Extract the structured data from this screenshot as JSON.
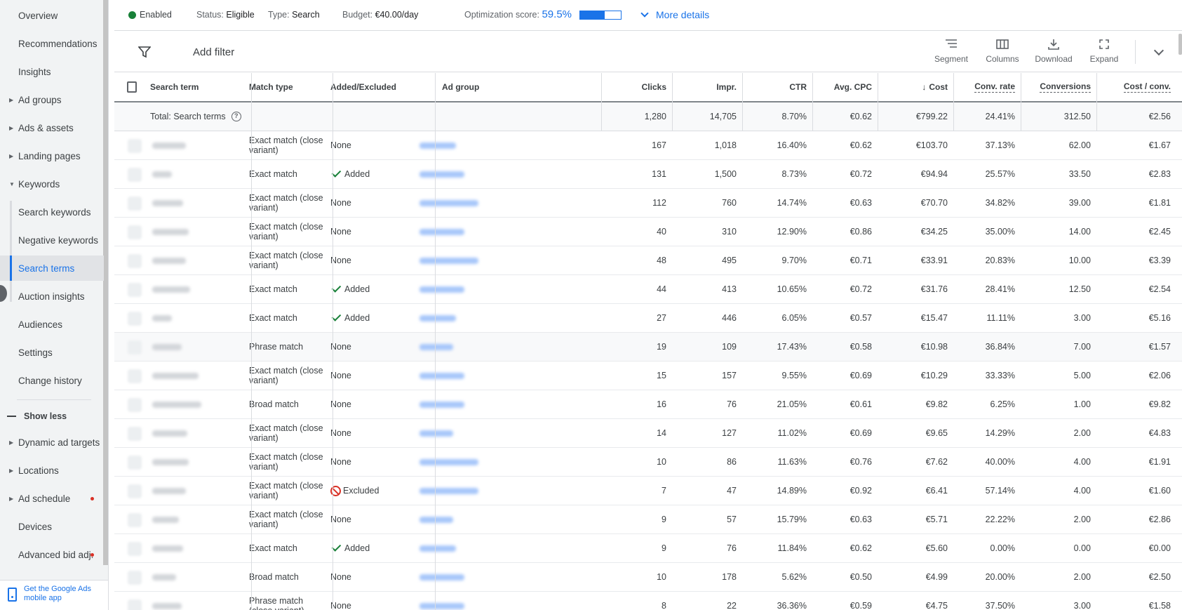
{
  "sidebar": {
    "items": [
      {
        "label": "Overview",
        "caret": false
      },
      {
        "label": "Recommendations",
        "caret": false
      },
      {
        "label": "Insights",
        "caret": false
      },
      {
        "label": "Ad groups",
        "caret": true
      },
      {
        "label": "Ads & assets",
        "caret": true
      },
      {
        "label": "Landing pages",
        "caret": true
      },
      {
        "label": "Keywords",
        "caret": "open"
      },
      {
        "label": "Search keywords",
        "sub": true
      },
      {
        "label": "Negative keywords",
        "sub": true
      },
      {
        "label": "Search terms",
        "sub": true,
        "selected": true
      },
      {
        "label": "Auction insights",
        "sub": true
      },
      {
        "label": "Audiences",
        "caret": false
      },
      {
        "label": "Settings",
        "caret": false
      },
      {
        "label": "Change history",
        "caret": false
      }
    ],
    "show_less": "Show less",
    "more_items": [
      {
        "label": "Dynamic ad targets",
        "caret": true,
        "dot": false
      },
      {
        "label": "Locations",
        "caret": true,
        "dot": false
      },
      {
        "label": "Ad schedule",
        "caret": true,
        "dot": true
      },
      {
        "label": "Devices",
        "caret": false,
        "dot": false
      },
      {
        "label": "Advanced bid adj.",
        "caret": false,
        "dot": true
      }
    ],
    "mobile_app": "Get the Google Ads mobile app"
  },
  "status": {
    "enabled": "Enabled",
    "status_label": "Status:",
    "status_value": "Eligible",
    "type_label": "Type:",
    "type_value": "Search",
    "budget_label": "Budget:",
    "budget_value": "€40.00/day",
    "opt_label": "Optimization score:",
    "opt_value": "59.5%",
    "opt_fraction": 0.595,
    "more_details": "More details"
  },
  "toolbar": {
    "add_filter": "Add filter",
    "segment": "Segment",
    "columns": "Columns",
    "download": "Download",
    "expand": "Expand"
  },
  "table": {
    "headers": {
      "search_term": "Search term",
      "match_type": "Match type",
      "added_excluded": "Added/Excluded",
      "ad_group": "Ad group",
      "clicks": "Clicks",
      "impr": "Impr.",
      "ctr": "CTR",
      "avg_cpc": "Avg. CPC",
      "cost": "Cost",
      "conv_rate": "Conv. rate",
      "conversions": "Conversions",
      "cost_conv": "Cost / conv."
    },
    "total": {
      "label": "Total: Search terms",
      "clicks": "1,280",
      "impr": "14,705",
      "ctr": "8.70%",
      "avg_cpc": "€0.62",
      "cost": "€799.22",
      "conv_rate": "24.41%",
      "conversions": "312.50",
      "cost_conv": "€2.56"
    },
    "rows": [
      {
        "match": "Exact match (close variant)",
        "status": "None",
        "clicks": "167",
        "impr": "1,018",
        "ctr": "16.40%",
        "cpc": "€0.62",
        "cost": "€103.70",
        "conv_rate": "37.13%",
        "conv": "62.00",
        "cost_conv": "€1.67"
      },
      {
        "match": "Exact match",
        "status": "Added",
        "clicks": "131",
        "impr": "1,500",
        "ctr": "8.73%",
        "cpc": "€0.72",
        "cost": "€94.94",
        "conv_rate": "25.57%",
        "conv": "33.50",
        "cost_conv": "€2.83"
      },
      {
        "match": "Exact match (close variant)",
        "status": "None",
        "clicks": "112",
        "impr": "760",
        "ctr": "14.74%",
        "cpc": "€0.63",
        "cost": "€70.70",
        "conv_rate": "34.82%",
        "conv": "39.00",
        "cost_conv": "€1.81"
      },
      {
        "match": "Exact match (close variant)",
        "status": "None",
        "clicks": "40",
        "impr": "310",
        "ctr": "12.90%",
        "cpc": "€0.86",
        "cost": "€34.25",
        "conv_rate": "35.00%",
        "conv": "14.00",
        "cost_conv": "€2.45"
      },
      {
        "match": "Exact match (close variant)",
        "status": "None",
        "clicks": "48",
        "impr": "495",
        "ctr": "9.70%",
        "cpc": "€0.71",
        "cost": "€33.91",
        "conv_rate": "20.83%",
        "conv": "10.00",
        "cost_conv": "€3.39"
      },
      {
        "match": "Exact match",
        "status": "Added",
        "clicks": "44",
        "impr": "413",
        "ctr": "10.65%",
        "cpc": "€0.72",
        "cost": "€31.76",
        "conv_rate": "28.41%",
        "conv": "12.50",
        "cost_conv": "€2.54"
      },
      {
        "match": "Exact match",
        "status": "Added",
        "clicks": "27",
        "impr": "446",
        "ctr": "6.05%",
        "cpc": "€0.57",
        "cost": "€15.47",
        "conv_rate": "11.11%",
        "conv": "3.00",
        "cost_conv": "€5.16"
      },
      {
        "match": "Phrase match",
        "status": "None",
        "clicks": "19",
        "impr": "109",
        "ctr": "17.43%",
        "cpc": "€0.58",
        "cost": "€10.98",
        "conv_rate": "36.84%",
        "conv": "7.00",
        "cost_conv": "€1.57"
      },
      {
        "match": "Exact match (close variant)",
        "status": "None",
        "clicks": "15",
        "impr": "157",
        "ctr": "9.55%",
        "cpc": "€0.69",
        "cost": "€10.29",
        "conv_rate": "33.33%",
        "conv": "5.00",
        "cost_conv": "€2.06"
      },
      {
        "match": "Broad match",
        "status": "None",
        "clicks": "16",
        "impr": "76",
        "ctr": "21.05%",
        "cpc": "€0.61",
        "cost": "€9.82",
        "conv_rate": "6.25%",
        "conv": "1.00",
        "cost_conv": "€9.82"
      },
      {
        "match": "Exact match (close variant)",
        "status": "None",
        "clicks": "14",
        "impr": "127",
        "ctr": "11.02%",
        "cpc": "€0.69",
        "cost": "€9.65",
        "conv_rate": "14.29%",
        "conv": "2.00",
        "cost_conv": "€4.83"
      },
      {
        "match": "Exact match (close variant)",
        "status": "None",
        "clicks": "10",
        "impr": "86",
        "ctr": "11.63%",
        "cpc": "€0.76",
        "cost": "€7.62",
        "conv_rate": "40.00%",
        "conv": "4.00",
        "cost_conv": "€1.91"
      },
      {
        "match": "Exact match (close variant)",
        "status": "Excluded",
        "clicks": "7",
        "impr": "47",
        "ctr": "14.89%",
        "cpc": "€0.92",
        "cost": "€6.41",
        "conv_rate": "57.14%",
        "conv": "4.00",
        "cost_conv": "€1.60"
      },
      {
        "match": "Exact match (close variant)",
        "status": "None",
        "clicks": "9",
        "impr": "57",
        "ctr": "15.79%",
        "cpc": "€0.63",
        "cost": "€5.71",
        "conv_rate": "22.22%",
        "conv": "2.00",
        "cost_conv": "€2.86"
      },
      {
        "match": "Exact match",
        "status": "Added",
        "clicks": "9",
        "impr": "76",
        "ctr": "11.84%",
        "cpc": "€0.62",
        "cost": "€5.60",
        "conv_rate": "0.00%",
        "conv": "0.00",
        "cost_conv": "€0.00"
      },
      {
        "match": "Broad match",
        "status": "None",
        "clicks": "10",
        "impr": "178",
        "ctr": "5.62%",
        "cpc": "€0.50",
        "cost": "€4.99",
        "conv_rate": "20.00%",
        "conv": "2.00",
        "cost_conv": "€2.50"
      },
      {
        "match": "Phrase match (close variant)",
        "status": "None",
        "clicks": "8",
        "impr": "22",
        "ctr": "36.36%",
        "cpc": "€0.59",
        "cost": "€4.75",
        "conv_rate": "37.50%",
        "conv": "3.00",
        "cost_conv": "€1.58"
      }
    ]
  },
  "colors": {
    "accent": "#1a73e8",
    "enabled": "#188038",
    "excluded": "#d93025"
  }
}
